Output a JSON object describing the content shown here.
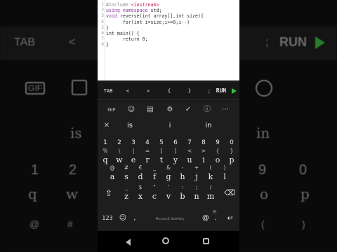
{
  "editor": {
    "line_numbers": [
      "1",
      "2",
      "3",
      "4",
      "5",
      "6",
      "7",
      "8",
      "9",
      "10"
    ],
    "lines": [
      {
        "pre": "#include ",
        "kw": "",
        "name": "<iostream>",
        "rest": ""
      },
      {
        "pre": "",
        "kw": "using namespace ",
        "name": "",
        "rest": "std;"
      },
      {
        "pre": "",
        "kw": "void ",
        "name": "",
        "rest": "reverse(int array[],int size){"
      },
      {
        "pre": "",
        "kw": "",
        "name": "",
        "rest": "      for(int i=size;i>=0;i--)"
      },
      {
        "pre": "",
        "kw": "",
        "name": "",
        "rest": "}"
      },
      {
        "pre": "",
        "kw": "",
        "name": "",
        "rest": "int main() {"
      },
      {
        "pre": "",
        "kw": "",
        "name": "",
        "rest": "      return 0;"
      },
      {
        "pre": "",
        "kw": "",
        "name": "",
        "rest": "}"
      }
    ]
  },
  "toolbar": {
    "tab": "TAB",
    "lt": "<",
    "gt": ">",
    "lbrace": "{",
    "rbrace": "}",
    "semicolon": ";",
    "run": "RUN",
    "run_color": "#3bbf3b"
  },
  "keyboard": {
    "suggestions": [
      "is",
      "i",
      "in"
    ],
    "number_row": [
      "1",
      "2",
      "3",
      "4",
      "5",
      "6",
      "7",
      "8",
      "9",
      "0"
    ],
    "row1": [
      [
        "%",
        "q"
      ],
      [
        "\\",
        "w"
      ],
      [
        "|",
        "e"
      ],
      [
        "=",
        "r"
      ],
      [
        "[",
        "t"
      ],
      [
        "]",
        "y"
      ],
      [
        "<",
        "u"
      ],
      [
        ">",
        "i"
      ],
      [
        "{",
        "o"
      ],
      [
        "}",
        "p"
      ]
    ],
    "row2": [
      [
        "@",
        "a"
      ],
      [
        "#",
        "s"
      ],
      [
        "€",
        "d"
      ],
      [
        "_",
        "f"
      ],
      [
        "&",
        "g"
      ],
      [
        "-",
        "h"
      ],
      [
        "+",
        "j"
      ],
      [
        "(",
        "k"
      ],
      [
        ")",
        "l"
      ]
    ],
    "row3": [
      [
        "_",
        "z"
      ],
      [
        "$",
        "x"
      ],
      [
        "\"",
        "c"
      ],
      [
        "'",
        "v"
      ],
      [
        ":",
        "b"
      ],
      [
        ";",
        "n"
      ],
      [
        "/",
        "m"
      ]
    ],
    "bottom": {
      "numbers": "123",
      "emoji": "☺",
      "comma": ",",
      "space_label": "Microsoft SwiftKey",
      "at": "@",
      "period": ".",
      "punct": "?!"
    }
  },
  "background_text": {
    "tab": "TAB",
    "lt": "<",
    "semicolon": ";",
    "run": "RUN",
    "gif": "GIF",
    "keys_left_num": [
      "1",
      "2"
    ],
    "keys_right_num": [
      "9",
      "0"
    ]
  }
}
